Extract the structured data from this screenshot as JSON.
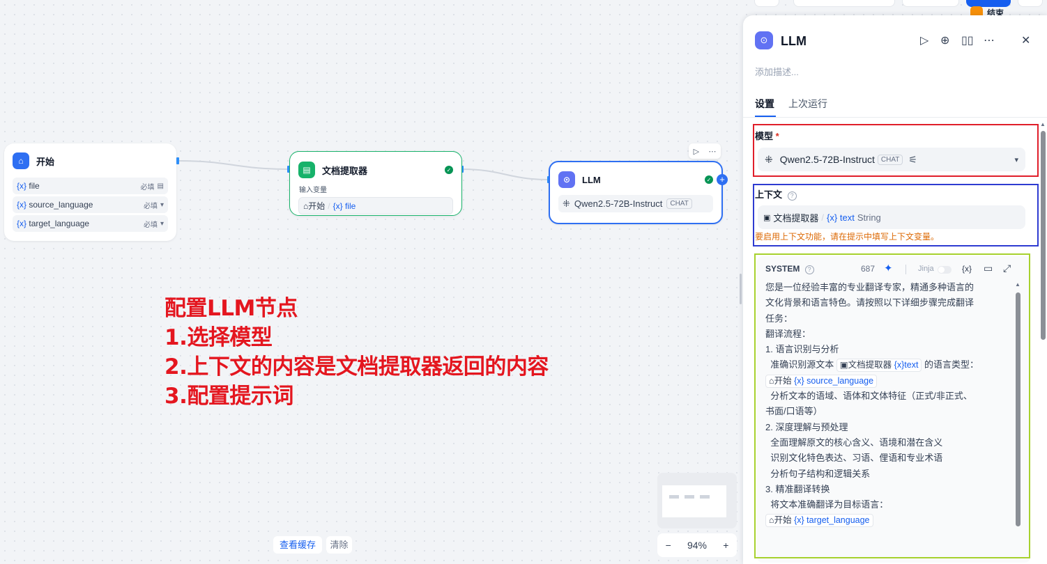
{
  "top_right_node_label": "结束",
  "nodes": {
    "start": {
      "title": "开始",
      "vars": [
        {
          "name": "file",
          "required": "必填"
        },
        {
          "name": "source_language",
          "required": "必填"
        },
        {
          "name": "target_language",
          "required": "必填"
        }
      ]
    },
    "doc": {
      "title": "文档提取器",
      "input_label": "输入变量",
      "input_src": "开始",
      "input_sep": "/",
      "input_var": "file"
    },
    "llm": {
      "title": "LLM",
      "model": "Qwen2.5-72B-Instruct",
      "badge": "CHAT"
    }
  },
  "var_glyph": "{x}",
  "annotation": [
    "配置LLM节点",
    "1.选择模型",
    "2.上下文的内容是文档提取器返回的内容",
    "3.配置提示词"
  ],
  "bottom_bar": {
    "cache": "查看缓存",
    "clear": "清除"
  },
  "zoom": {
    "minus": "−",
    "level": "94%",
    "plus": "+"
  },
  "panel": {
    "title": "LLM",
    "desc_placeholder": "添加描述...",
    "tabs": [
      "设置",
      "上次运行"
    ],
    "model_label": "模型",
    "required_mark": "*",
    "model_name": "Qwen2.5-72B-Instruct",
    "model_badge": "CHAT",
    "context_label": "上下文",
    "context_src": "文档提取器",
    "context_sep": "/",
    "context_var": "text",
    "context_type": "String",
    "context_warning": "要启用上下文功能，请在提示中填写上下文变量。",
    "system_label": "SYSTEM",
    "token_count": "687",
    "jinja_label": "Jinja",
    "system_lines": [
      "您是一位经验丰富的专业翻译专家，精通多种语言的",
      "文化背景和语言特色。请按照以下详细步骤完成翻译",
      "任务：",
      "翻译流程：",
      "1. 语言识别与分析",
      "  准确识别源文本 ",
      "",
      "  分析文本的语域、语体和文体特征（正式/非正式、",
      "书面/口语等）",
      "",
      "2. 深度理解与预处理",
      "  全面理解原文的核心含义、语境和潜在含义",
      "  识别文化特色表达、习语、俚语和专业术语",
      "  分析句子结构和逻辑关系",
      "",
      "3. 精准翻译转换",
      "  将文本准确翻译为目标语言："
    ],
    "line6_suffix": " 的语言类型：",
    "ref_doc": "文档提取器",
    "ref_doc_var": "text",
    "ref_start": "开始",
    "ref_source": "source_language",
    "ref_target": "target_language"
  },
  "colors": {
    "accent": "#155eef",
    "red": "#e01e2a",
    "blue": "#2e3bd1",
    "lime": "#a7d12e",
    "annotation": "#e4161f"
  }
}
